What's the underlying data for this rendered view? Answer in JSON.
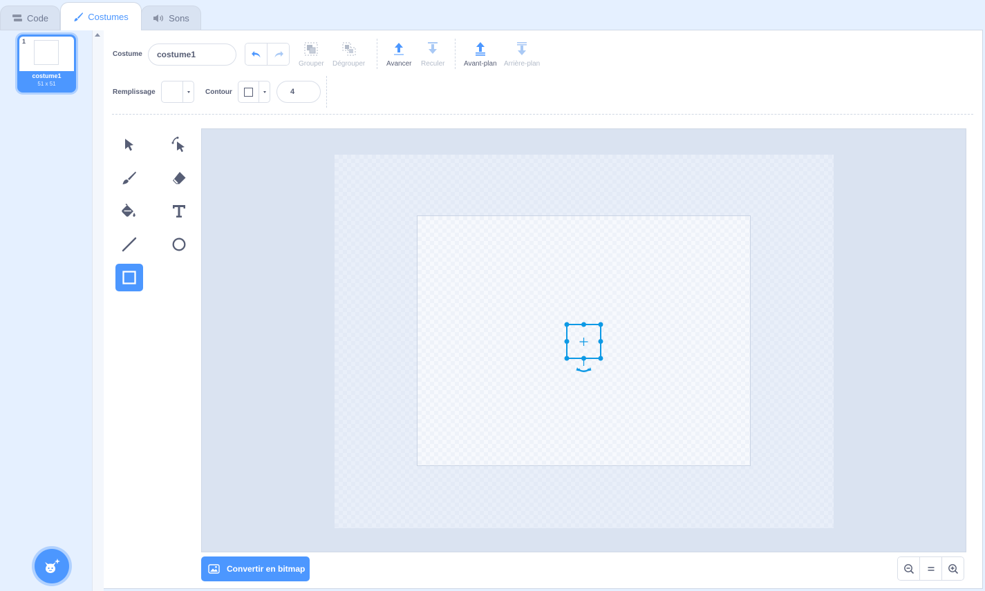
{
  "tabs": [
    {
      "label": "Code",
      "icon": "code-blocks-icon"
    },
    {
      "label": "Costumes",
      "icon": "brush-icon"
    },
    {
      "label": "Sons",
      "icon": "speaker-icon"
    }
  ],
  "costume_list": {
    "items": [
      {
        "index": "1",
        "name": "costume1",
        "size": "51 x 51"
      }
    ],
    "add_icon": "cat-add-icon"
  },
  "toolbar": {
    "costume_label": "Costume",
    "costume_name": "costume1",
    "group": "Grouper",
    "ungroup": "Dégrouper",
    "forward": "Avancer",
    "backward": "Reculer",
    "front": "Avant-plan",
    "back": "Arrière-plan",
    "fill_label": "Remplissage",
    "outline_label": "Contour",
    "stroke_width": "4"
  },
  "tools": [
    "select",
    "reshape",
    "brush",
    "eraser",
    "fill",
    "text",
    "line",
    "circle",
    "rectangle"
  ],
  "active_tool": "rectangle",
  "bottom": {
    "convert_bitmap": "Convertir en bitmap"
  },
  "colors": {
    "accent": "#4c97ff",
    "selection": "#0d99e5",
    "text": "#575e75"
  }
}
